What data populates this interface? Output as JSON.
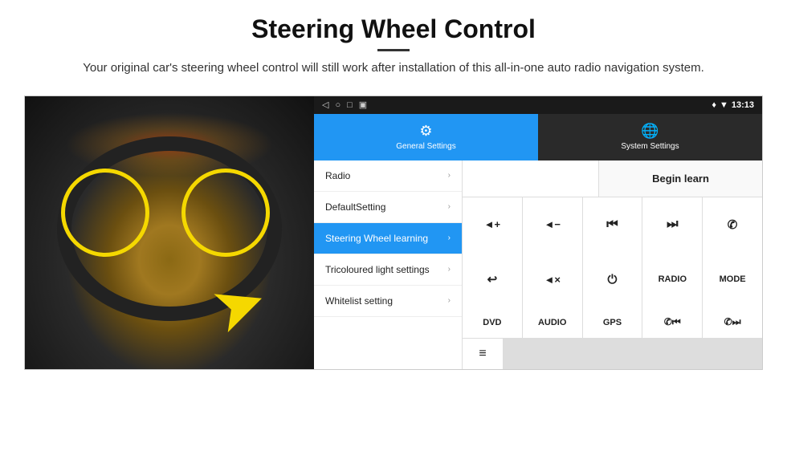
{
  "header": {
    "title": "Steering Wheel Control",
    "subtitle": "Your original car's steering wheel control will still work after installation of this all-in-one auto radio navigation system."
  },
  "status_bar": {
    "nav_icons": [
      "◁",
      "○",
      "□",
      "▣"
    ],
    "right_icons": "♦ ▼",
    "time": "13:13"
  },
  "tabs": [
    {
      "id": "general",
      "label": "General Settings",
      "icon": "⚙",
      "active": true
    },
    {
      "id": "system",
      "label": "System Settings",
      "icon": "🌐",
      "active": false
    }
  ],
  "menu_items": [
    {
      "id": "radio",
      "label": "Radio",
      "active": false
    },
    {
      "id": "default",
      "label": "DefaultSetting",
      "active": false
    },
    {
      "id": "steering",
      "label": "Steering Wheel learning",
      "active": true
    },
    {
      "id": "tricoloured",
      "label": "Tricoloured light settings",
      "active": false
    },
    {
      "id": "whitelist",
      "label": "Whitelist setting",
      "active": false
    }
  ],
  "begin_learn_button": "Begin learn",
  "control_buttons": {
    "row1": [
      {
        "id": "vol-up",
        "symbol": "🔊+",
        "text": "◄+"
      },
      {
        "id": "vol-down",
        "symbol": "🔈-",
        "text": "◄−"
      },
      {
        "id": "prev-track",
        "symbol": "⏮",
        "text": "⏮"
      },
      {
        "id": "next-track",
        "symbol": "⏭",
        "text": "⏭"
      },
      {
        "id": "phone",
        "symbol": "📞",
        "text": "✆"
      }
    ],
    "row2": [
      {
        "id": "hang-up",
        "symbol": "↪",
        "text": "↩"
      },
      {
        "id": "mute",
        "symbol": "🔇",
        "text": "◄×"
      },
      {
        "id": "power",
        "symbol": "⏻",
        "text": "⏻"
      },
      {
        "id": "radio-btn",
        "text": "RADIO"
      },
      {
        "id": "mode-btn",
        "text": "MODE"
      }
    ],
    "row3": [
      {
        "id": "dvd-btn",
        "text": "DVD"
      },
      {
        "id": "audio-btn",
        "text": "AUDIO"
      },
      {
        "id": "gps-btn",
        "text": "GPS"
      },
      {
        "id": "tel-prev",
        "symbol": "📞⏮",
        "text": "✆⏮"
      },
      {
        "id": "tel-next",
        "symbol": "📞⏭",
        "text": "✆⏭"
      }
    ]
  },
  "whitelist_icon": "≡"
}
